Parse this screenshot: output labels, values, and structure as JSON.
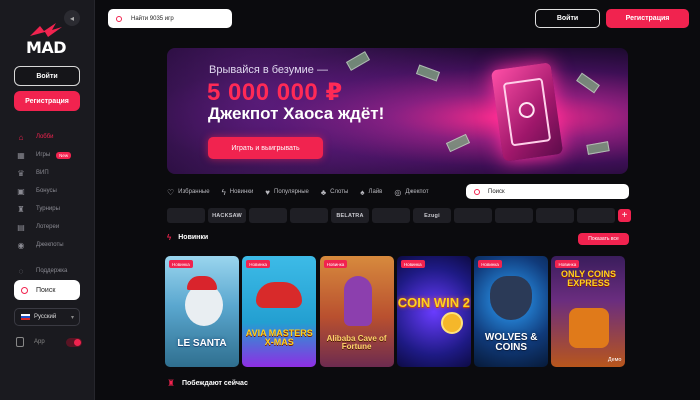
{
  "sidebar": {
    "logo_text": "MAD",
    "login_label": "Войти",
    "register_label": "Регистрация",
    "nav": [
      {
        "label": "Лобби",
        "icon": "home-icon",
        "active": true
      },
      {
        "label": "Игры",
        "icon": "games-icon",
        "badge": "New"
      },
      {
        "label": "ВИП",
        "icon": "vip-icon"
      },
      {
        "label": "Бонусы",
        "icon": "gift-icon"
      },
      {
        "label": "Турниры",
        "icon": "trophy-icon"
      },
      {
        "label": "Лотереи",
        "icon": "ticket-icon"
      },
      {
        "label": "Джекпоты",
        "icon": "jackpot-icon"
      },
      {
        "label": "Поддержка",
        "icon": "support-icon"
      }
    ],
    "search_label": "Поиск",
    "language": "Русский",
    "app_label": "App"
  },
  "header": {
    "search_placeholder": "Найти 9035 игр",
    "login_label": "Войти",
    "register_label": "Регистрация"
  },
  "banner": {
    "line1": "Врывайся в безумие —",
    "line2": "5 000 000 ₽",
    "line3": "Джекпот Хаоса ждёт!",
    "cta": "Играть и выигрывать"
  },
  "categories": [
    {
      "label": "Избранные",
      "icon": "heart-icon"
    },
    {
      "label": "Новинки",
      "icon": "lightning-icon"
    },
    {
      "label": "Популярные",
      "icon": "heart-icon"
    },
    {
      "label": "Слоты",
      "icon": "cherry-icon"
    },
    {
      "label": "Лайв",
      "icon": "dealer-icon"
    },
    {
      "label": "Джекпот",
      "icon": "jackpot-icon"
    }
  ],
  "category_search_placeholder": "Поиск",
  "providers": [
    "",
    "HACKSAW",
    "",
    "",
    "BELATRA",
    "",
    "Ezugi",
    "",
    "",
    "",
    ""
  ],
  "section_new": {
    "title": "Новинки",
    "show_all": "Показать все"
  },
  "games": [
    {
      "badge": "Новинка",
      "title": "LE SANTA",
      "demo": ""
    },
    {
      "badge": "Новинка",
      "title": "AVIA MASTERS X-MAS",
      "demo": ""
    },
    {
      "badge": "Новинка",
      "title": "Alibaba Cave of Fortune",
      "demo": ""
    },
    {
      "badge": "Новинка",
      "title": "COIN WIN 2",
      "demo": ""
    },
    {
      "badge": "Новинка",
      "title": "WOLVES & COINS",
      "demo": ""
    },
    {
      "badge": "Новинка",
      "title": "ONLY COINS EXPRESS",
      "demo": "Демо"
    }
  ],
  "section_winners": {
    "title": "Побеждают сейчас"
  },
  "colors": {
    "accent": "#f1234f",
    "background": "#0b0b0e",
    "sidebar": "#1a1a1f"
  }
}
